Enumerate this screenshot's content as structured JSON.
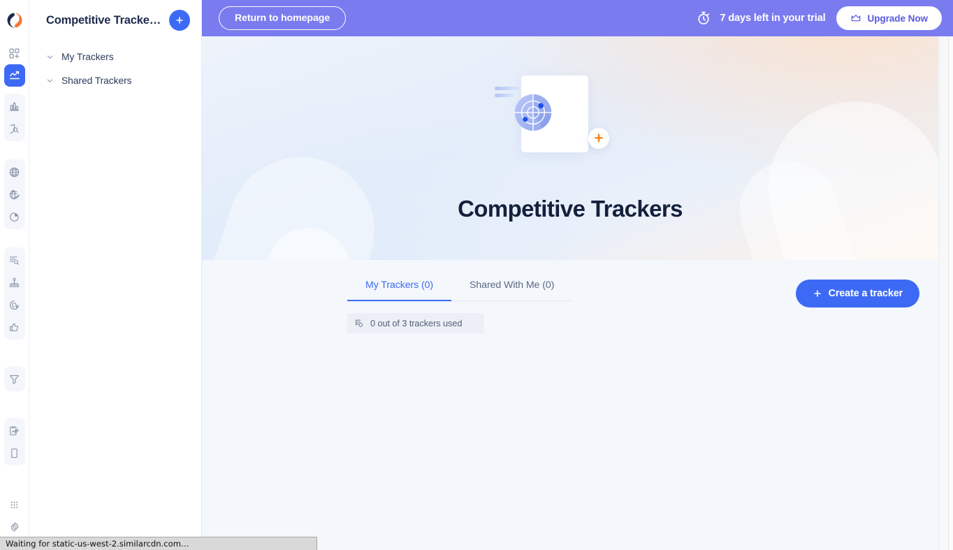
{
  "app": {
    "logo_icon": "similarweb-logo-icon"
  },
  "rail": {
    "groups": [
      {
        "items": [
          {
            "icon": "dashboard-add-icon",
            "active": false,
            "name": "rail-item-dashboards"
          },
          {
            "icon": "trend-chart-icon",
            "active": true,
            "name": "rail-item-competitive-trackers"
          }
        ]
      },
      {
        "items": [
          {
            "icon": "bar-chart-icon",
            "active": false,
            "name": "rail-item-benchmarking"
          },
          {
            "icon": "shield-search-icon",
            "active": false,
            "name": "rail-item-research"
          }
        ]
      },
      {
        "items": [
          {
            "icon": "globe-icon",
            "active": false,
            "name": "rail-item-web-analysis"
          },
          {
            "icon": "globe-trend-icon",
            "active": false,
            "name": "rail-item-market-trends"
          },
          {
            "icon": "pie-chart-icon",
            "active": false,
            "name": "rail-item-audience"
          }
        ]
      },
      {
        "items": [
          {
            "icon": "list-search-icon",
            "active": false,
            "name": "rail-item-keyword-research"
          },
          {
            "icon": "network-nodes-icon",
            "active": false,
            "name": "rail-item-traffic-sources"
          },
          {
            "icon": "target-click-icon",
            "active": false,
            "name": "rail-item-ads"
          },
          {
            "icon": "thumbs-up-icon",
            "active": false,
            "name": "rail-item-engagement"
          }
        ]
      },
      {
        "items": [
          {
            "icon": "funnel-filter-icon",
            "active": false,
            "name": "rail-item-funnel"
          }
        ]
      },
      {
        "items": [
          {
            "icon": "report-edit-icon",
            "active": false,
            "name": "rail-item-reports"
          },
          {
            "icon": "mobile-device-icon",
            "active": false,
            "name": "rail-item-app-analysis"
          }
        ]
      },
      {
        "items": [
          {
            "icon": "grid-apps-icon",
            "active": false,
            "name": "rail-item-apps"
          },
          {
            "icon": "gear-icon",
            "active": false,
            "name": "rail-item-settings"
          }
        ]
      }
    ]
  },
  "sidebar": {
    "title": "Competitive Tracke…",
    "add_button_label": "+",
    "tree": [
      {
        "label": "My Trackers",
        "chevron": "chevron-down-icon"
      },
      {
        "label": "Shared Trackers",
        "chevron": "chevron-down-icon"
      }
    ]
  },
  "topbar": {
    "return_label": "Return to homepage",
    "trial_icon": "stopwatch-icon",
    "trial_text": "7 days left in your trial",
    "upgrade_icon": "crown-icon",
    "upgrade_label": "Upgrade Now",
    "background_color": "#7b7bf0"
  },
  "hero": {
    "title": "Competitive Trackers",
    "art_icon": "radar-tracker-illustration",
    "plus_badge": "+",
    "plus_badge_color": "#f58220"
  },
  "content": {
    "tabs": [
      {
        "label": "My Trackers (0)",
        "active": true,
        "name": "tab-my-trackers"
      },
      {
        "label": "Shared With Me (0)",
        "active": false,
        "name": "tab-shared-with-me"
      }
    ],
    "create_button": {
      "icon": "plus-icon",
      "label": "Create a tracker"
    },
    "quota": {
      "icon": "trackers-stack-icon",
      "text": "0 out of 3 trackers used"
    },
    "accent_color": "#3d6af5"
  },
  "statusbar": {
    "text": "Waiting for static-us-west-2.similarcdn.com…"
  }
}
